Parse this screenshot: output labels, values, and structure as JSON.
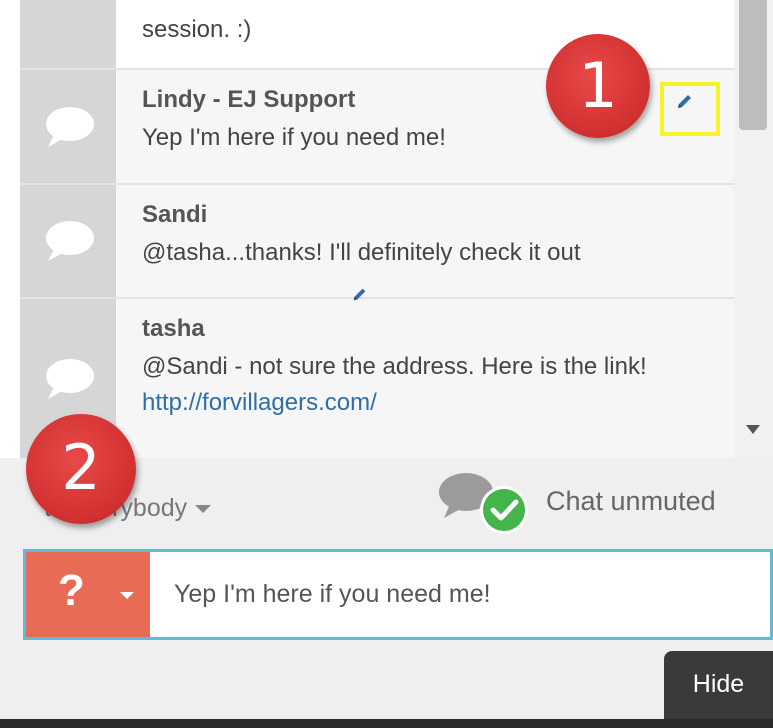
{
  "messages": [
    {
      "author": "",
      "text": "session. :)"
    },
    {
      "author": "Lindy - EJ Support",
      "text": "Yep I'm here if you need me!"
    },
    {
      "author": "Sandi",
      "text": "@tasha...thanks! I'll definitely check it out"
    },
    {
      "author": "tasha",
      "text": "@Sandi - not sure the address. Here is the link! ",
      "link": "http://forvillagers.com/"
    }
  ],
  "annotations": {
    "badge_1": "1",
    "badge_2": "2"
  },
  "recipient": {
    "label": "to everybody"
  },
  "mute_status": {
    "label": "Chat unmuted"
  },
  "composer": {
    "button_symbol": "?",
    "value": "Yep I'm here if you need me!"
  },
  "hide_button": {
    "label": "Hide"
  },
  "colors": {
    "badge": "#d6302f",
    "highlight": "#f6f32a",
    "composer_border": "#5fbbd9",
    "question_button": "#e86c55",
    "link": "#2f6ea8",
    "check_green": "#43b54a"
  },
  "icons": {
    "avatar": "speech-bubble-icon",
    "edit": "pencil-icon",
    "mute": "chat-unmuted-icon",
    "scroll": "triangle-down-icon"
  }
}
